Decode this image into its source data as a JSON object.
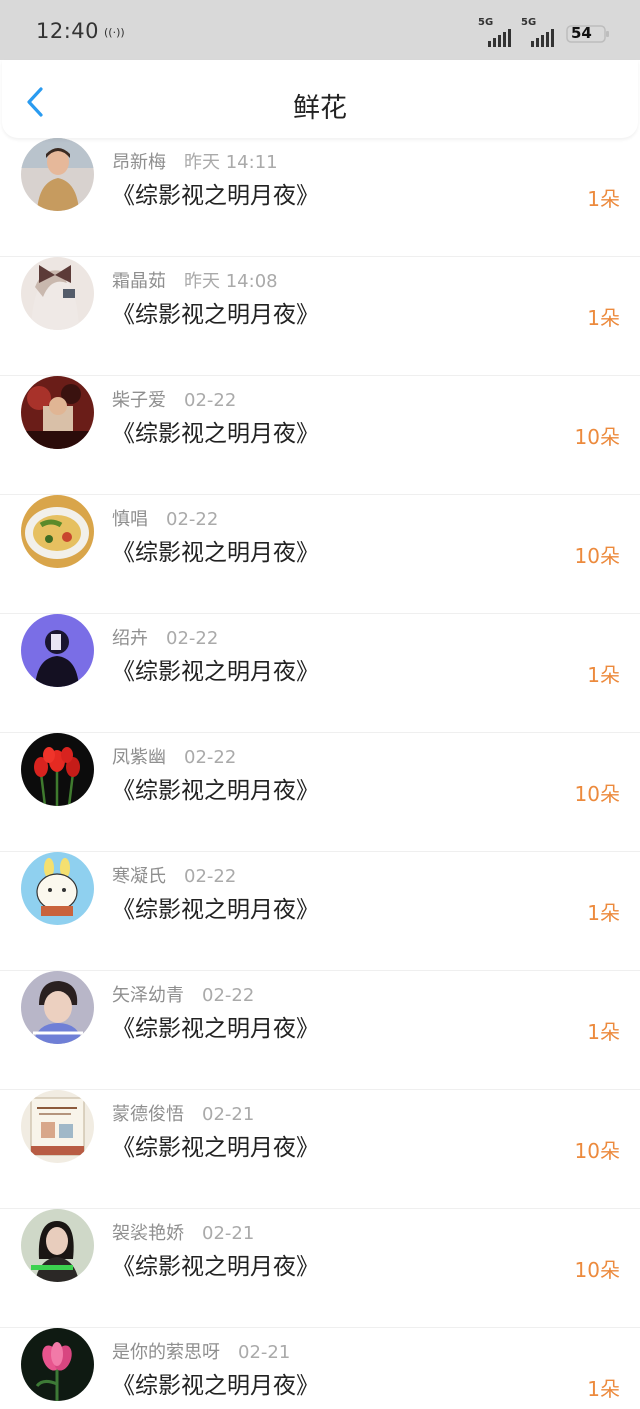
{
  "status_bar": {
    "time": "12:40",
    "hotspot_icon": "hotspot-icon",
    "net1": "5G",
    "net2": "5G",
    "battery": "54"
  },
  "header": {
    "title": "鲜花",
    "back_icon": "chevron-left-icon"
  },
  "colors": {
    "accent_blue": "#2a9bf0",
    "count_orange": "#ec8a3d"
  },
  "records": [
    {
      "name": "昂新梅",
      "time": "昨天 14:11",
      "book": "《综影视之明月夜》",
      "count": "1朵",
      "avatar": "person-in-sweater-avatar"
    },
    {
      "name": "霜晶茹",
      "time": "昨天 14:08",
      "book": "《综影视之明月夜》",
      "count": "1朵",
      "avatar": "girl-with-bow-avatar"
    },
    {
      "name": "柴子爱",
      "time": "02-22",
      "book": "《综影视之明月夜》",
      "count": "10朵",
      "avatar": "red-scene-avatar"
    },
    {
      "name": "慎唱",
      "time": "02-22",
      "book": "《综影视之明月夜》",
      "count": "10朵",
      "avatar": "noodles-avatar"
    },
    {
      "name": "绍卉",
      "time": "02-22",
      "book": "《综影视之明月夜》",
      "count": "1朵",
      "avatar": "purple-silhouette-avatar"
    },
    {
      "name": "凤紫幽",
      "time": "02-22",
      "book": "《综影视之明月夜》",
      "count": "10朵",
      "avatar": "red-tulips-avatar"
    },
    {
      "name": "寒凝氏",
      "time": "02-22",
      "book": "《综影视之明月夜》",
      "count": "1朵",
      "avatar": "cartoon-bunny-avatar"
    },
    {
      "name": "矢泽幼青",
      "time": "02-22",
      "book": "《综影视之明月夜》",
      "count": "1朵",
      "avatar": "boy-portrait-avatar"
    },
    {
      "name": "蒙德俊悟",
      "time": "02-21",
      "book": "《综影视之明月夜》",
      "count": "10朵",
      "avatar": "illustration-card-avatar"
    },
    {
      "name": "袈裟艳娇",
      "time": "02-21",
      "book": "《综影视之明月夜》",
      "count": "10朵",
      "avatar": "woman-portrait-avatar"
    },
    {
      "name": "是你的萦思呀",
      "time": "02-21",
      "book": "《综影视之明月夜》",
      "count": "1朵",
      "avatar": "pink-flower-avatar"
    }
  ]
}
